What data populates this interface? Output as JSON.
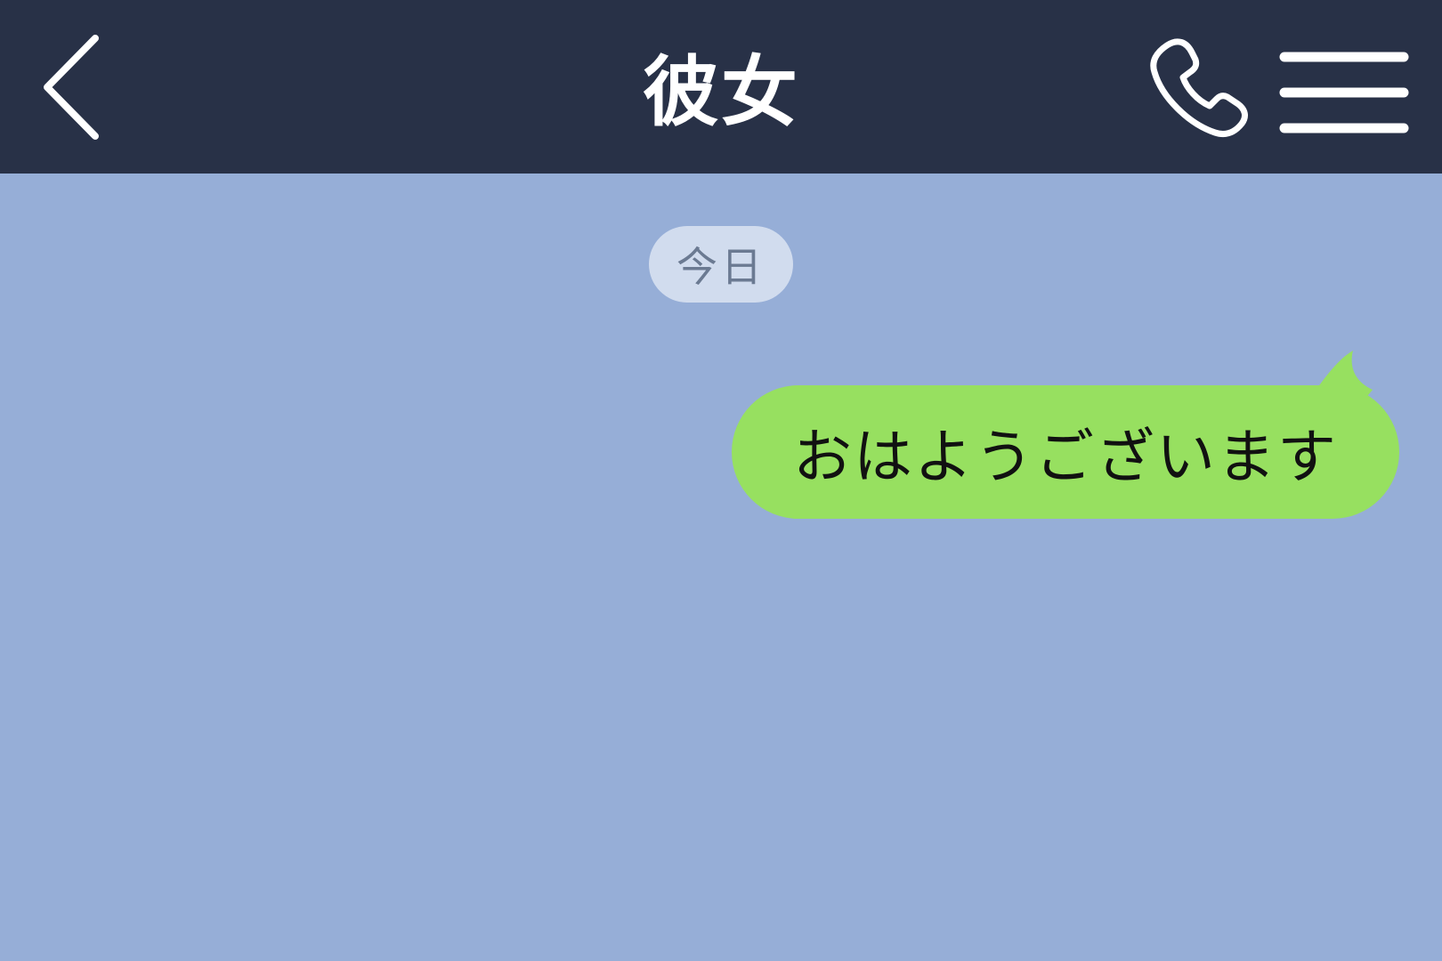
{
  "header": {
    "title": "彼女",
    "back_icon": "chevron-left-icon",
    "call_icon": "phone-icon",
    "menu_icon": "hamburger-menu-icon"
  },
  "chat": {
    "date_label": "今日",
    "messages": [
      {
        "text": "おはようございます",
        "direction": "sent"
      }
    ]
  },
  "colors": {
    "header_bg": "#283147",
    "chat_bg": "#96aed7",
    "sent_bubble": "#97e060",
    "date_pill_bg": "#d1dcee",
    "date_pill_text": "#6b7a92"
  }
}
